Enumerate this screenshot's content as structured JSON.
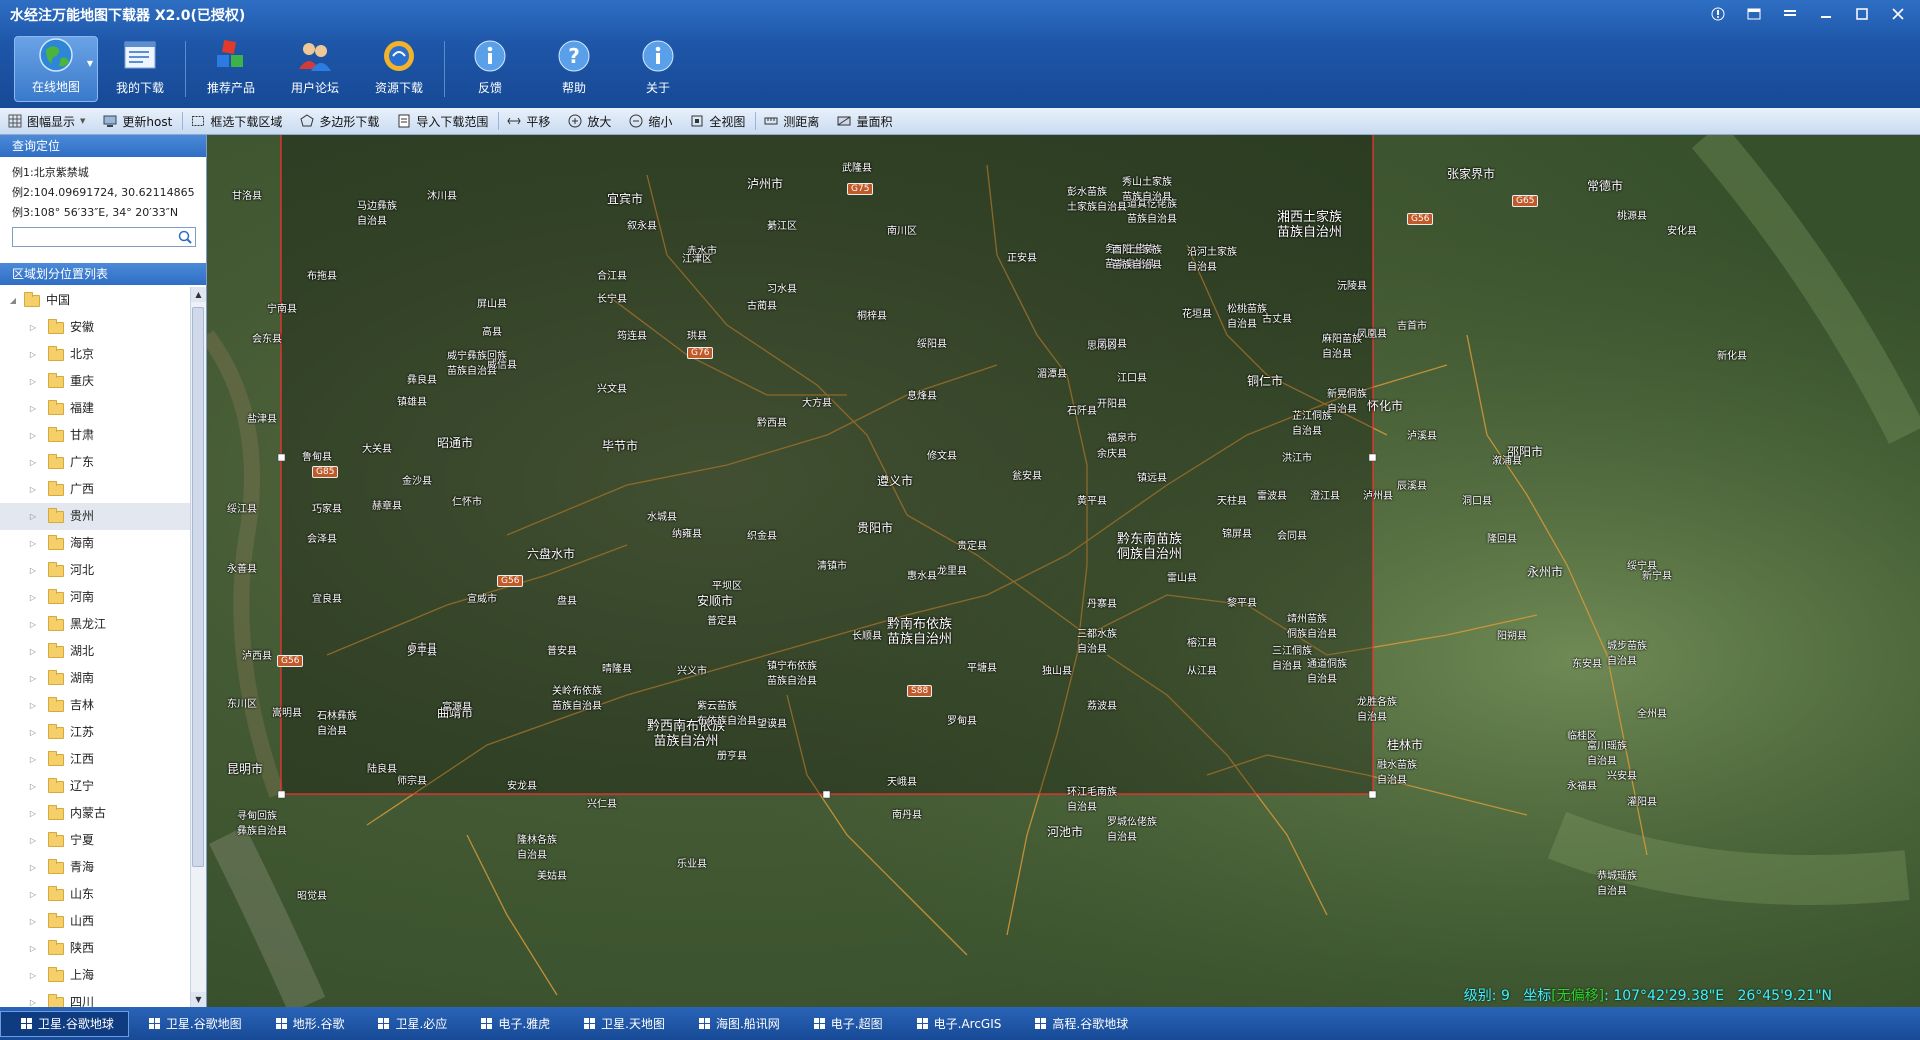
{
  "app": {
    "title": "水经注万能地图下载器 X2.0(已授权)"
  },
  "tools": [
    {
      "label": "在线地图",
      "icon": "globe-icon"
    },
    {
      "label": "我的下载",
      "icon": "download-list-icon"
    },
    {
      "label": "推荐产品",
      "icon": "cubes-icon"
    },
    {
      "label": "用户论坛",
      "icon": "users-icon"
    },
    {
      "label": "资源下载",
      "icon": "resource-icon"
    },
    {
      "label": "反馈",
      "icon": "info-icon"
    },
    {
      "label": "帮助",
      "icon": "help-icon"
    },
    {
      "label": "关于",
      "icon": "info-icon"
    }
  ],
  "subbar": [
    {
      "label": "图幅显示"
    },
    {
      "label": "更新host"
    },
    {
      "label": "框选下载区域"
    },
    {
      "label": "多边形下载"
    },
    {
      "label": "导入下载范围"
    },
    {
      "label": "平移"
    },
    {
      "label": "放大"
    },
    {
      "label": "缩小"
    },
    {
      "label": "全视图"
    },
    {
      "label": "测距离"
    },
    {
      "label": "量面积"
    }
  ],
  "query": {
    "header": "查询定位",
    "example1": "例1:北京紫禁城",
    "example2": "例2:104.09691724, 30.62114865",
    "example3": "例3:108° 56′33″E, 34° 20′33″N",
    "input_value": ""
  },
  "region": {
    "header": "区域划分位置列表",
    "root": "中国",
    "provinces": [
      "安徽",
      "北京",
      "重庆",
      "福建",
      "甘肃",
      "广东",
      "广西",
      "贵州",
      "海南",
      "河北",
      "河南",
      "黑龙江",
      "湖北",
      "湖南",
      "吉林",
      "江苏",
      "江西",
      "辽宁",
      "内蒙古",
      "宁夏",
      "青海",
      "山东",
      "山西",
      "陕西",
      "上海",
      "四川"
    ],
    "selected": "贵州"
  },
  "map": {
    "labels": [
      {
        "t": "泸州市",
        "c": "city"
      },
      {
        "t": "宜宾市",
        "c": "city"
      },
      {
        "t": "遵义市",
        "c": "city"
      },
      {
        "t": "毕节市",
        "c": "city"
      },
      {
        "t": "昭通市",
        "c": "city"
      },
      {
        "t": "六盘水市",
        "c": "city"
      },
      {
        "t": "贵阳市",
        "c": "city"
      },
      {
        "t": "安顺市",
        "c": "city"
      },
      {
        "t": "铜仁市",
        "c": "city"
      },
      {
        "t": "怀化市",
        "c": "city"
      },
      {
        "t": "曲靖市",
        "c": "city"
      },
      {
        "t": "河池市",
        "c": "city"
      },
      {
        "t": "桂林市",
        "c": "city"
      },
      {
        "t": "邵阳市",
        "c": "city"
      },
      {
        "t": "永州市",
        "c": "city"
      },
      {
        "t": "昆明市",
        "c": "city"
      },
      {
        "t": "张家界市",
        "c": "city"
      },
      {
        "t": "常德市",
        "c": "city"
      },
      {
        "t": "黔东南苗族\n侗族自治州",
        "c": "region"
      },
      {
        "t": "黔南布依族\n苗族自治州",
        "c": "region"
      },
      {
        "t": "黔西南布依族\n苗族自治州",
        "c": "region"
      },
      {
        "t": "湘西土家族\n苗族自治州",
        "c": "region"
      },
      {
        "t": "甘洛县"
      },
      {
        "t": "沐川县"
      },
      {
        "t": "马边彝族\n自治县"
      },
      {
        "t": "叙永县"
      },
      {
        "t": "古蔺县"
      },
      {
        "t": "赤水市"
      },
      {
        "t": "习水县"
      },
      {
        "t": "桐梓县"
      },
      {
        "t": "绥阳县"
      },
      {
        "t": "正安县"
      },
      {
        "t": "道真仡佬族\n苗族自治县"
      },
      {
        "t": "务川仡佬族\n苗族自治县"
      },
      {
        "t": "沿河土家族\n自治县"
      },
      {
        "t": "松桃苗族\n自治县"
      },
      {
        "t": "江口县"
      },
      {
        "t": "石阡县"
      },
      {
        "t": "思南县"
      },
      {
        "t": "湄潭县"
      },
      {
        "t": "凤冈县"
      },
      {
        "t": "余庆县"
      },
      {
        "t": "瓮安县"
      },
      {
        "t": "黄平县"
      },
      {
        "t": "镇远县"
      },
      {
        "t": "天柱县"
      },
      {
        "t": "锦屏县"
      },
      {
        "t": "黎平县"
      },
      {
        "t": "从江县"
      },
      {
        "t": "榕江县"
      },
      {
        "t": "雷山县"
      },
      {
        "t": "丹寨县"
      },
      {
        "t": "三都水族\n自治县"
      },
      {
        "t": "荔波县"
      },
      {
        "t": "独山县"
      },
      {
        "t": "平塘县"
      },
      {
        "t": "罗甸县"
      },
      {
        "t": "长顺县"
      },
      {
        "t": "惠水县"
      },
      {
        "t": "龙里县"
      },
      {
        "t": "贵定县"
      },
      {
        "t": "福泉市"
      },
      {
        "t": "开阳县"
      },
      {
        "t": "息烽县"
      },
      {
        "t": "修文县"
      },
      {
        "t": "清镇市"
      },
      {
        "t": "平坝区"
      },
      {
        "t": "普定县"
      },
      {
        "t": "镇宁布依族\n苗族自治县"
      },
      {
        "t": "紫云苗族\n布依族自治县"
      },
      {
        "t": "关岭布依族\n苗族自治县"
      },
      {
        "t": "晴隆县"
      },
      {
        "t": "普安县"
      },
      {
        "t": "兴仁县"
      },
      {
        "t": "安龙县"
      },
      {
        "t": "兴义市"
      },
      {
        "t": "册亨县"
      },
      {
        "t": "望谟县"
      },
      {
        "t": "贞丰县"
      },
      {
        "t": "盘县"
      },
      {
        "t": "水城县"
      },
      {
        "t": "纳雍县"
      },
      {
        "t": "织金县"
      },
      {
        "t": "黔西县"
      },
      {
        "t": "大方县"
      },
      {
        "t": "金沙县"
      },
      {
        "t": "仁怀市"
      },
      {
        "t": "赫章县"
      },
      {
        "t": "威宁彝族回族\n苗族自治县"
      },
      {
        "t": "镇雄县"
      },
      {
        "t": "威信县"
      },
      {
        "t": "彝良县"
      },
      {
        "t": "大关县"
      },
      {
        "t": "鲁甸县"
      },
      {
        "t": "巧家县"
      },
      {
        "t": "会泽县"
      },
      {
        "t": "宣威市"
      },
      {
        "t": "富源县"
      },
      {
        "t": "罗平县"
      },
      {
        "t": "师宗县"
      },
      {
        "t": "陆良县"
      },
      {
        "t": "石林彝族\n自治县"
      },
      {
        "t": "宜良县"
      },
      {
        "t": "东川区"
      },
      {
        "t": "寻甸回族\n彝族自治县"
      },
      {
        "t": "嵩明县"
      },
      {
        "t": "泸西县"
      },
      {
        "t": "隆林各族\n自治县"
      },
      {
        "t": "乐业县"
      },
      {
        "t": "天峨县"
      },
      {
        "t": "南丹县"
      },
      {
        "t": "环江毛南族\n自治县"
      },
      {
        "t": "罗城仫佬族\n自治县"
      },
      {
        "t": "融水苗族\n自治县"
      },
      {
        "t": "三江侗族\n自治县"
      },
      {
        "t": "龙胜各族\n自治县"
      },
      {
        "t": "通道侗族\n自治县"
      },
      {
        "t": "靖州苗族\n侗族自治县"
      },
      {
        "t": "会同县"
      },
      {
        "t": "洪江市"
      },
      {
        "t": "芷江侗族\n自治县"
      },
      {
        "t": "新晃侗族\n自治县"
      },
      {
        "t": "麻阳苗族\n自治县"
      },
      {
        "t": "凤凰县"
      },
      {
        "t": "吉首市"
      },
      {
        "t": "泸溪县"
      },
      {
        "t": "辰溪县"
      },
      {
        "t": "溆浦县"
      },
      {
        "t": "隆回县"
      },
      {
        "t": "洞口县"
      },
      {
        "t": "绥宁县"
      },
      {
        "t": "城步苗族\n自治县"
      },
      {
        "t": "新宁县"
      },
      {
        "t": "东安县"
      },
      {
        "t": "全州县"
      },
      {
        "t": "兴安县"
      },
      {
        "t": "灌阳县"
      },
      {
        "t": "恭城瑶族\n自治县"
      },
      {
        "t": "永福县"
      },
      {
        "t": "临桂区"
      },
      {
        "t": "阳朔县"
      },
      {
        "t": "富川瑶族\n自治县"
      },
      {
        "t": "新化县"
      },
      {
        "t": "安化县"
      },
      {
        "t": "桃源县"
      },
      {
        "t": "沅陵县"
      },
      {
        "t": "古丈县"
      },
      {
        "t": "花垣县"
      },
      {
        "t": "秀山土家族\n苗族自治县"
      },
      {
        "t": "酉阳土家族\n苗族自治县"
      },
      {
        "t": "彭水苗族\n土家族自治县"
      },
      {
        "t": "武隆县"
      },
      {
        "t": "南川区"
      },
      {
        "t": "綦江区"
      },
      {
        "t": "江津区"
      },
      {
        "t": "合江县"
      },
      {
        "t": "长宁县"
      },
      {
        "t": "珙县"
      },
      {
        "t": "筠连县"
      },
      {
        "t": "兴文县"
      },
      {
        "t": "高县"
      },
      {
        "t": "屏山县"
      },
      {
        "t": "绥江县"
      },
      {
        "t": "永善县"
      },
      {
        "t": "盐津县"
      },
      {
        "t": "宁南县"
      },
      {
        "t": "会东县"
      },
      {
        "t": "布拖县"
      },
      {
        "t": "昭觉县"
      },
      {
        "t": "美姑县"
      },
      {
        "t": "雷波县"
      },
      {
        "t": "澄江县"
      },
      {
        "t": "泸州县"
      }
    ],
    "shields": [
      "G75",
      "G76",
      "G85",
      "G56",
      "G56",
      "G65",
      "S88",
      "G56"
    ],
    "status": {
      "level_label": "级别:",
      "level": "9",
      "coord_label": "坐标",
      "coord_tag": "[无偏移]",
      "lon": "107°42'29.38\"E",
      "lat": "26°45'9.21\"N"
    }
  },
  "bottom_tabs": [
    {
      "label": "卫星.谷歌地球",
      "active": true
    },
    {
      "label": "卫星.谷歌地图"
    },
    {
      "label": "地形.谷歌"
    },
    {
      "label": "卫星.必应"
    },
    {
      "label": "电子.雅虎"
    },
    {
      "label": "卫星.天地图"
    },
    {
      "label": "海图.船讯网"
    },
    {
      "label": "电子.超图"
    },
    {
      "label": "电子.ArcGIS"
    },
    {
      "label": "高程.谷歌地球"
    }
  ],
  "colors": {
    "accent": "#1e56a8",
    "selection": "#ff3030",
    "status": "#3ef0ff"
  }
}
